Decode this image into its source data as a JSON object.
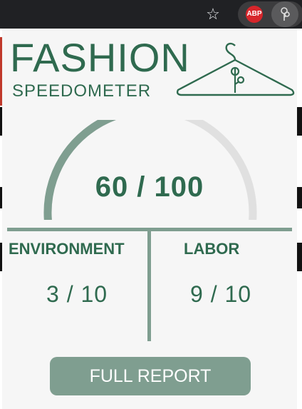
{
  "toolbar": {
    "bookmark_icon": "star-outline-icon",
    "extensions": [
      {
        "name": "adblock-plus",
        "label": "ABP",
        "color": "#d7262b"
      },
      {
        "name": "fashion-speedometer",
        "icon": "hanger-leaf-icon"
      }
    ]
  },
  "logo": {
    "title": "FASHION",
    "subtitle": "SPEEDOMETER",
    "icon": "hanger-icon"
  },
  "score": {
    "value": 60,
    "max": 100,
    "display": "60 / 100"
  },
  "categories": {
    "environment": {
      "label": "ENVIRONMENT",
      "display": "3 / 10",
      "value": 3,
      "max": 10
    },
    "labor": {
      "label": "LABOR",
      "display": "9 / 10",
      "value": 9,
      "max": 10
    }
  },
  "actions": {
    "full_report": "FULL REPORT"
  },
  "colors": {
    "primary_green": "#2f6a4f",
    "accent_sage": "#7f9e90",
    "gauge_track": "#e0e0e0",
    "popup_bg": "#f6f6f6"
  }
}
